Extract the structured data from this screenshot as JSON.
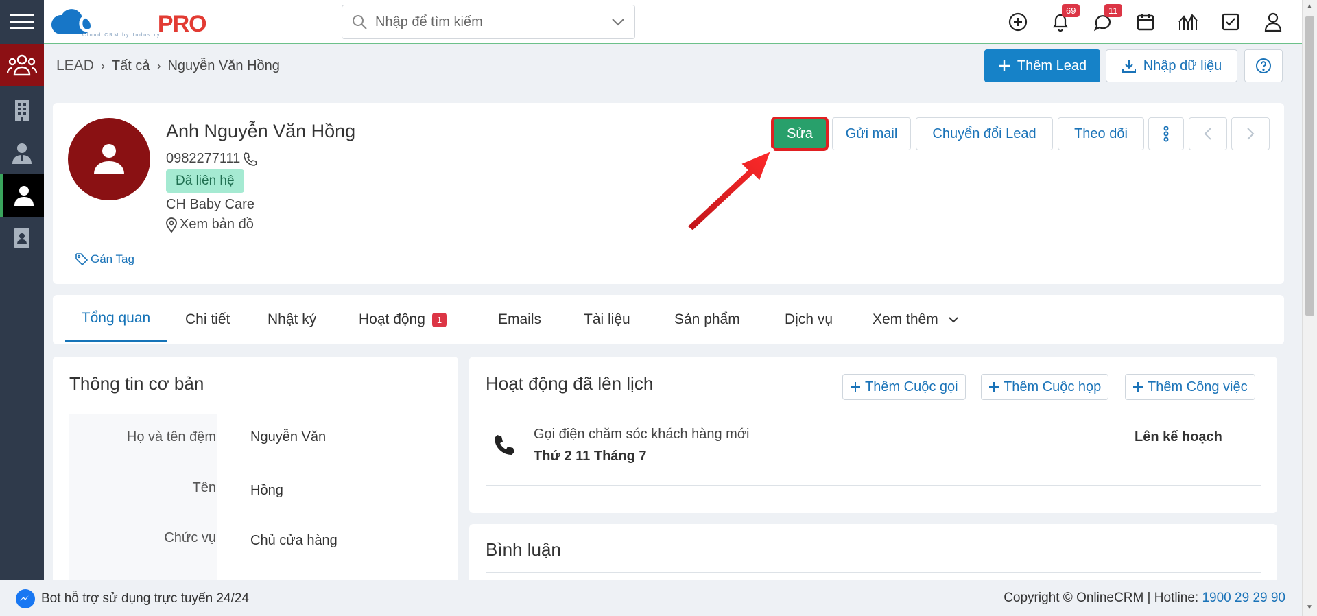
{
  "app": {
    "logo_main": "CLOUD",
    "logo_accent": "PRO",
    "logo_sub": "Cloud CRM by Industry"
  },
  "search": {
    "placeholder": "Nhập để tìm kiếm"
  },
  "header": {
    "notifications_count": "69",
    "messages_count": "11"
  },
  "breadcrumb": {
    "root": "LEAD",
    "level1": "Tất cả",
    "current": "Nguyễn Văn Hồng"
  },
  "toolbar": {
    "add_lead": "Thêm Lead",
    "import": "Nhập dữ liệu"
  },
  "profile": {
    "name": "Anh Nguyễn Văn Hồng",
    "phone": "0982277111",
    "status": "Đã liên hệ",
    "company": "CH Baby Care",
    "map_link": "Xem bản đồ",
    "tag_link": "Gán Tag",
    "actions": {
      "edit": "Sửa",
      "send_mail": "Gửi mail",
      "convert": "Chuyển đổi Lead",
      "follow": "Theo dõi"
    }
  },
  "tabs": [
    {
      "label": "Tổng quan"
    },
    {
      "label": "Chi tiết"
    },
    {
      "label": "Nhật ký"
    },
    {
      "label": "Hoạt động",
      "badge": "1"
    },
    {
      "label": "Emails"
    },
    {
      "label": "Tài liệu"
    },
    {
      "label": "Sản phẩm"
    },
    {
      "label": "Dịch vụ"
    },
    {
      "label": "Xem thêm"
    }
  ],
  "basic_info": {
    "title": "Thông tin cơ bản",
    "rows": [
      {
        "label": "Họ và tên đệm",
        "value": "Nguyễn Văn"
      },
      {
        "label": "Tên",
        "value": "Hồng"
      },
      {
        "label": "Chức vụ",
        "value": "Chủ cửa hàng"
      }
    ]
  },
  "activities": {
    "title": "Hoạt động đã lên lịch",
    "add_call": "Thêm Cuộc gọi",
    "add_meeting": "Thêm Cuộc họp",
    "add_task": "Thêm Công việc",
    "items": [
      {
        "title": "Gọi điện chăm sóc khách hàng mới",
        "date": "Thứ 2 11 Tháng 7",
        "status": "Lên kế hoạch"
      }
    ]
  },
  "comments": {
    "title": "Bình luận"
  },
  "footer": {
    "bot": "Bot hỗ trợ sử dụng trực tuyến 24/24",
    "copyright": "Copyright © OnlineCRM",
    "hotline_label": "Hotline:",
    "hotline": "1900 29 29 90"
  },
  "colors": {
    "primary": "#1682c8",
    "edit_button": "#28a06b",
    "highlight": "#e02022",
    "sidebar": "#2f3a4b",
    "sidebar_active_module": "#8c1014",
    "status_badge": "#a5ead2"
  }
}
